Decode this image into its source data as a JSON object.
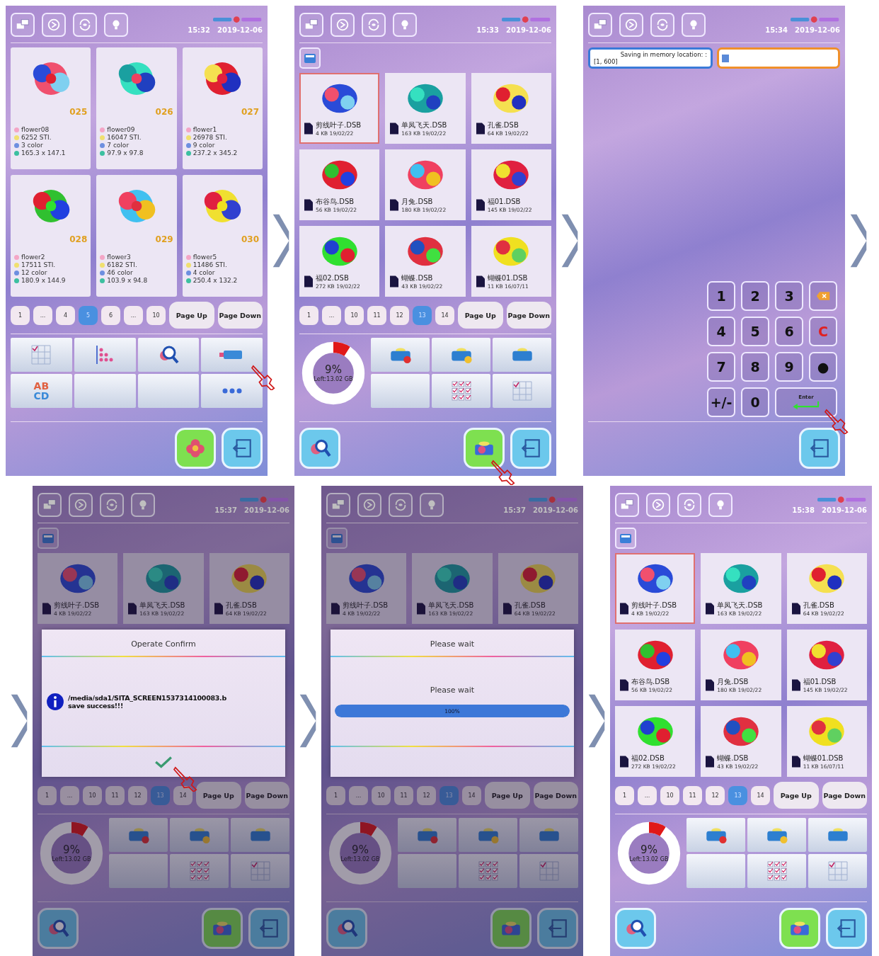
{
  "panels": [
    {
      "kind": "memory",
      "dimmed": false,
      "time": "15:32",
      "date": "2019-12-06",
      "designs": [
        {
          "number": "025",
          "name": "flower08",
          "stitches": "6252 STI.",
          "colors": "3 color",
          "size": "165.3 x 147.1"
        },
        {
          "number": "026",
          "name": "flower09",
          "stitches": "16047 STI.",
          "colors": "7 color",
          "size": "97.9 x 97.8"
        },
        {
          "number": "027",
          "name": "flower1",
          "stitches": "26978 STI.",
          "colors": "9 color",
          "size": "237.2 x 345.2"
        },
        {
          "number": "028",
          "name": "flower2",
          "stitches": "17511 STI.",
          "colors": "12 color",
          "size": "180.9 x 144.9"
        },
        {
          "number": "029",
          "name": "flower3",
          "stitches": "6182 STI.",
          "colors": "46 color",
          "size": "103.9 x 94.8"
        },
        {
          "number": "030",
          "name": "flower5",
          "stitches": "11486 STI.",
          "colors": "4 color",
          "size": "250.4 x 132.2"
        }
      ],
      "pages": [
        {
          "label": "1",
          "selected": false
        },
        {
          "label": "...",
          "selected": false
        },
        {
          "label": "4",
          "selected": false
        },
        {
          "label": "5",
          "selected": true
        },
        {
          "label": "6",
          "selected": false
        },
        {
          "label": "...",
          "selected": false
        },
        {
          "label": "10",
          "selected": false
        }
      ],
      "page_up": "Page Up",
      "page_down": "Page Down",
      "tools": [
        {
          "kind": "grid_check",
          "touch": false
        },
        {
          "kind": "dots",
          "touch": false
        },
        {
          "kind": "search",
          "touch": false
        },
        {
          "kind": "usb",
          "touch": true
        },
        {
          "kind": "letters",
          "lines": [
            "AB",
            "CD"
          ],
          "touch": false
        },
        {
          "kind": "blank",
          "touch": false
        },
        {
          "kind": "blank",
          "touch": false
        },
        {
          "kind": "more",
          "touch": false
        }
      ],
      "actions": [
        {
          "kind": "flower",
          "touch": false
        },
        {
          "kind": "exit",
          "touch": false
        }
      ]
    },
    {
      "kind": "files",
      "dimmed": false,
      "time": "15:33",
      "date": "2019-12-06",
      "files": [
        {
          "name": "剪线叶子.DSB",
          "info": "4 KB 19/02/22",
          "selected": true
        },
        {
          "name": "单凤飞天.DSB",
          "info": "163 KB 19/02/22",
          "selected": false
        },
        {
          "name": "孔雀.DSB",
          "info": "64 KB 19/02/22",
          "selected": false
        },
        {
          "name": "布谷鸟.DSB",
          "info": "56 KB 19/02/22",
          "selected": false
        },
        {
          "name": "月兔.DSB",
          "info": "180 KB 19/02/22",
          "selected": false
        },
        {
          "name": "福01.DSB",
          "info": "145 KB 19/02/22",
          "selected": false
        },
        {
          "name": "福02.DSB",
          "info": "272 KB 19/02/22",
          "selected": false
        },
        {
          "name": "蝴蝶.DSB",
          "info": "43 KB 19/02/22",
          "selected": false
        },
        {
          "name": "蝴蝶01.DSB",
          "info": "11 KB 16/07/11",
          "selected": false
        }
      ],
      "pages": [
        {
          "label": "1",
          "selected": false
        },
        {
          "label": "...",
          "selected": false
        },
        {
          "label": "10",
          "selected": false
        },
        {
          "label": "11",
          "selected": false
        },
        {
          "label": "12",
          "selected": false
        },
        {
          "label": "13",
          "selected": true
        },
        {
          "label": "14",
          "selected": false
        }
      ],
      "page_up": "Page Up",
      "page_down": "Page Down",
      "storage": {
        "level": 0.09,
        "percent": "9%",
        "left": "Left:13.02 GB"
      },
      "tools": [
        {
          "kind": "folder_delete"
        },
        {
          "kind": "folder_add"
        },
        {
          "kind": "folder"
        },
        {
          "kind": "blank"
        },
        {
          "kind": "select_all"
        },
        {
          "kind": "grid_check"
        }
      ],
      "actions": [
        {
          "kind": "search",
          "touch": false
        },
        {
          "kind": "save",
          "touch": true
        },
        {
          "kind": "exit",
          "touch": false
        }
      ]
    },
    {
      "kind": "keypad",
      "dimmed": false,
      "time": "15:34",
      "date": "2019-12-06",
      "prompt": {
        "label": "Saving in memory location: :",
        "range": "[1, 600]"
      },
      "keys": [
        {
          "kind": "char",
          "label": "1",
          "touch": false
        },
        {
          "kind": "char",
          "label": "2",
          "touch": false
        },
        {
          "kind": "char",
          "label": "3",
          "touch": false
        },
        {
          "kind": "backspace",
          "touch": false
        },
        {
          "kind": "char",
          "label": "4",
          "touch": false
        },
        {
          "kind": "char",
          "label": "5",
          "touch": false
        },
        {
          "kind": "char",
          "label": "6",
          "touch": false
        },
        {
          "kind": "clear",
          "label": "C",
          "touch": false
        },
        {
          "kind": "char",
          "label": "7",
          "touch": false
        },
        {
          "kind": "char",
          "label": "8",
          "touch": false
        },
        {
          "kind": "char",
          "label": "9",
          "touch": false
        },
        {
          "kind": "char",
          "label": "●",
          "touch": false
        },
        {
          "kind": "char",
          "label": "+/-",
          "touch": false
        },
        {
          "kind": "char",
          "label": "0",
          "touch": false
        },
        {
          "kind": "enter",
          "label": "Enter",
          "touch": true
        }
      ],
      "actions": [
        {
          "kind": "exit",
          "touch": false
        }
      ]
    },
    {
      "kind": "files",
      "dimmed": true,
      "time": "15:37",
      "date": "2019-12-06",
      "files": [
        {
          "name": "剪线叶子.DSB",
          "info": "4 KB 19/02/22",
          "selected": false
        },
        {
          "name": "单凤飞天.DSB",
          "info": "163 KB 19/02/22",
          "selected": false
        },
        {
          "name": "孔雀.DSB",
          "info": "64 KB 19/02/22",
          "selected": false
        }
      ],
      "dialog": {
        "kind": "confirm",
        "title": "Operate Confirm",
        "message": [
          "/media/sda1/SITA_SCREEN1537314100083.b",
          "save success!!!"
        ],
        "touch": true
      },
      "pages": [
        {
          "label": "1",
          "selected": false
        },
        {
          "label": "...",
          "selected": false
        },
        {
          "label": "10",
          "selected": false
        },
        {
          "label": "11",
          "selected": false
        },
        {
          "label": "12",
          "selected": false
        },
        {
          "label": "13",
          "selected": true
        },
        {
          "label": "14",
          "selected": false
        }
      ],
      "page_up": "Page Up",
      "page_down": "Page Down",
      "storage": {
        "level": 0.09,
        "percent": "9%",
        "left": "Left:13.02 GB"
      },
      "tools": [
        {
          "kind": "folder_delete"
        },
        {
          "kind": "folder_add"
        },
        {
          "kind": "folder"
        },
        {
          "kind": "blank"
        },
        {
          "kind": "select_all"
        },
        {
          "kind": "grid_check"
        }
      ],
      "actions": [
        {
          "kind": "search",
          "touch": false
        },
        {
          "kind": "save",
          "touch": false
        },
        {
          "kind": "exit",
          "touch": false
        }
      ]
    },
    {
      "kind": "files",
      "dimmed": true,
      "time": "15:37",
      "date": "2019-12-06",
      "files": [
        {
          "name": "剪线叶子.DSB",
          "info": "4 KB 19/02/22",
          "selected": false
        },
        {
          "name": "单凤飞天.DSB",
          "info": "163 KB 19/02/22",
          "selected": false
        },
        {
          "name": "孔雀.DSB",
          "info": "64 KB 19/02/22",
          "selected": false
        }
      ],
      "dialog": {
        "kind": "progress",
        "title": "Please wait",
        "message": [
          "Please wait"
        ],
        "level": 1,
        "reading": "100%"
      },
      "pages": [
        {
          "label": "1",
          "selected": false
        },
        {
          "label": "...",
          "selected": false
        },
        {
          "label": "10",
          "selected": false
        },
        {
          "label": "11",
          "selected": false
        },
        {
          "label": "12",
          "selected": false
        },
        {
          "label": "13",
          "selected": true
        },
        {
          "label": "14",
          "selected": false
        }
      ],
      "page_up": "Page Up",
      "page_down": "Page Down",
      "storage": {
        "level": 0.09,
        "percent": "9%",
        "left": "Left:13.02 GB"
      },
      "tools": [
        {
          "kind": "folder_delete"
        },
        {
          "kind": "folder_add"
        },
        {
          "kind": "folder"
        },
        {
          "kind": "blank"
        },
        {
          "kind": "select_all"
        },
        {
          "kind": "grid_check"
        }
      ],
      "actions": [
        {
          "kind": "search",
          "touch": false
        },
        {
          "kind": "save",
          "touch": false
        },
        {
          "kind": "exit",
          "touch": false
        }
      ]
    },
    {
      "kind": "files",
      "dimmed": false,
      "time": "15:38",
      "date": "2019-12-06",
      "files": [
        {
          "name": "剪线叶子.DSB",
          "info": "4 KB 19/02/22",
          "selected": true
        },
        {
          "name": "单凤飞天.DSB",
          "info": "163 KB 19/02/22",
          "selected": false
        },
        {
          "name": "孔雀.DSB",
          "info": "64 KB 19/02/22",
          "selected": false
        },
        {
          "name": "布谷鸟.DSB",
          "info": "56 KB 19/02/22",
          "selected": false
        },
        {
          "name": "月兔.DSB",
          "info": "180 KB 19/02/22",
          "selected": false
        },
        {
          "name": "福01.DSB",
          "info": "145 KB 19/02/22",
          "selected": false
        },
        {
          "name": "福02.DSB",
          "info": "272 KB 19/02/22",
          "selected": false
        },
        {
          "name": "蝴蝶.DSB",
          "info": "43 KB 19/02/22",
          "selected": false
        },
        {
          "name": "蝴蝶01.DSB",
          "info": "11 KB 16/07/11",
          "selected": false
        }
      ],
      "pages": [
        {
          "label": "1",
          "selected": false
        },
        {
          "label": "...",
          "selected": false
        },
        {
          "label": "10",
          "selected": false
        },
        {
          "label": "11",
          "selected": false
        },
        {
          "label": "12",
          "selected": false
        },
        {
          "label": "13",
          "selected": true
        },
        {
          "label": "14",
          "selected": false
        }
      ],
      "page_up": "Page Up",
      "page_down": "Page Down",
      "storage": {
        "level": 0.09,
        "percent": "9%",
        "left": "Left:13.02 GB"
      },
      "tools": [
        {
          "kind": "folder_delete"
        },
        {
          "kind": "folder_add"
        },
        {
          "kind": "folder"
        },
        {
          "kind": "blank"
        },
        {
          "kind": "select_all"
        },
        {
          "kind": "grid_check"
        }
      ],
      "actions": [
        {
          "kind": "search",
          "touch": false
        },
        {
          "kind": "save",
          "touch": false
        },
        {
          "kind": "exit",
          "touch": false
        }
      ]
    }
  ]
}
